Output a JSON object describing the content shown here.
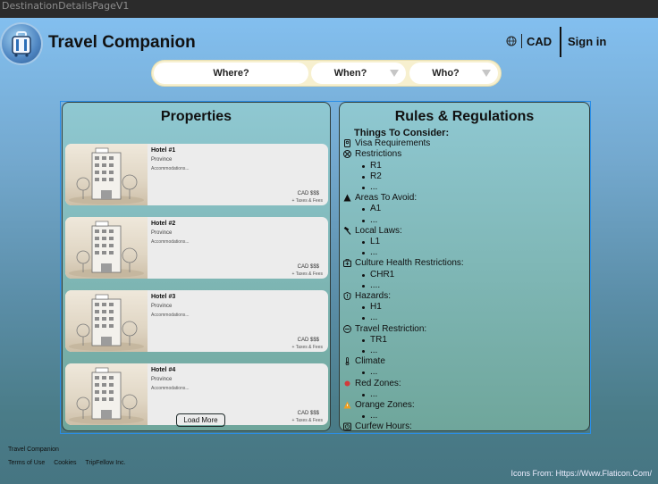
{
  "frame": {
    "label": "DestinationDetailsPageV1"
  },
  "header": {
    "brand": "Travel Companion",
    "currency": "CAD",
    "sign_in": "Sign in",
    "icons": {
      "logo": "travel-companion-logo",
      "currency": "globe-icon"
    }
  },
  "search": {
    "where": "Where?",
    "when": "When?",
    "who": "Who?"
  },
  "properties": {
    "title": "Properties",
    "hotels": [
      {
        "name": "Hotel #1",
        "province": "Province",
        "accommodations": "Accommodations...",
        "price": "CAD $$$",
        "fees": "+ Taxes & Fees"
      },
      {
        "name": "Hotel #2",
        "province": "Province",
        "accommodations": "Accommodations...",
        "price": "CAD $$$",
        "fees": "+ Taxes & Fees"
      },
      {
        "name": "Hotel #3",
        "province": "Province",
        "accommodations": "Accommodations...",
        "price": "CAD $$$",
        "fees": "+ Taxes & Fees"
      },
      {
        "name": "Hotel #4",
        "province": "Province",
        "accommodations": "Accommodations...",
        "price": "CAD $$$",
        "fees": "+ Taxes & Fees"
      }
    ],
    "load_more": "Load More"
  },
  "rules": {
    "title": "Rules & Regulations",
    "heading": "Things To Consider:",
    "items": [
      {
        "label": "Visa Requirements",
        "icon": "passport-icon",
        "sub": []
      },
      {
        "label": "Restrictions",
        "icon": "restricted-icon",
        "sub": [
          "R1",
          "R2",
          "..."
        ]
      },
      {
        "label": "Areas To Avoid:",
        "icon": "warning-triangle-icon",
        "sub": [
          "A1",
          "..."
        ]
      },
      {
        "label": "Local Laws:",
        "icon": "gavel-icon",
        "sub": [
          "L1",
          "..."
        ]
      },
      {
        "label": "Culture Health Restrictions:",
        "icon": "medical-kit-icon",
        "sub": [
          "CHR1",
          "...."
        ]
      },
      {
        "label": "Hazards:",
        "icon": "hazard-icon",
        "sub": [
          "H1",
          "..."
        ]
      },
      {
        "label": "Travel Restriction:",
        "icon": "no-travel-icon",
        "sub": [
          "TR1",
          "..."
        ]
      },
      {
        "label": "Climate",
        "icon": "thermometer-icon",
        "sub": [
          "..."
        ]
      },
      {
        "label": "Red Zones:",
        "icon": "red-zone-icon",
        "sub": [
          "..."
        ]
      },
      {
        "label": "Orange Zones:",
        "icon": "orange-zone-icon",
        "sub": [
          "..."
        ]
      },
      {
        "label": "Curfew Hours:",
        "icon": "curfew-clock-icon",
        "sub": []
      }
    ]
  },
  "footer": {
    "brand": "Travel Companion",
    "links": [
      "Terms of Use",
      "Cookies",
      "TripFellow Inc."
    ],
    "credits": "Icons From: Https://Www.Flaticon.Com/"
  },
  "colors": {
    "accent_outline": "#2a8ee8",
    "search_bg": "#f7f0cf",
    "red_zone": "#d23b3b",
    "orange_zone": "#f0a020"
  }
}
